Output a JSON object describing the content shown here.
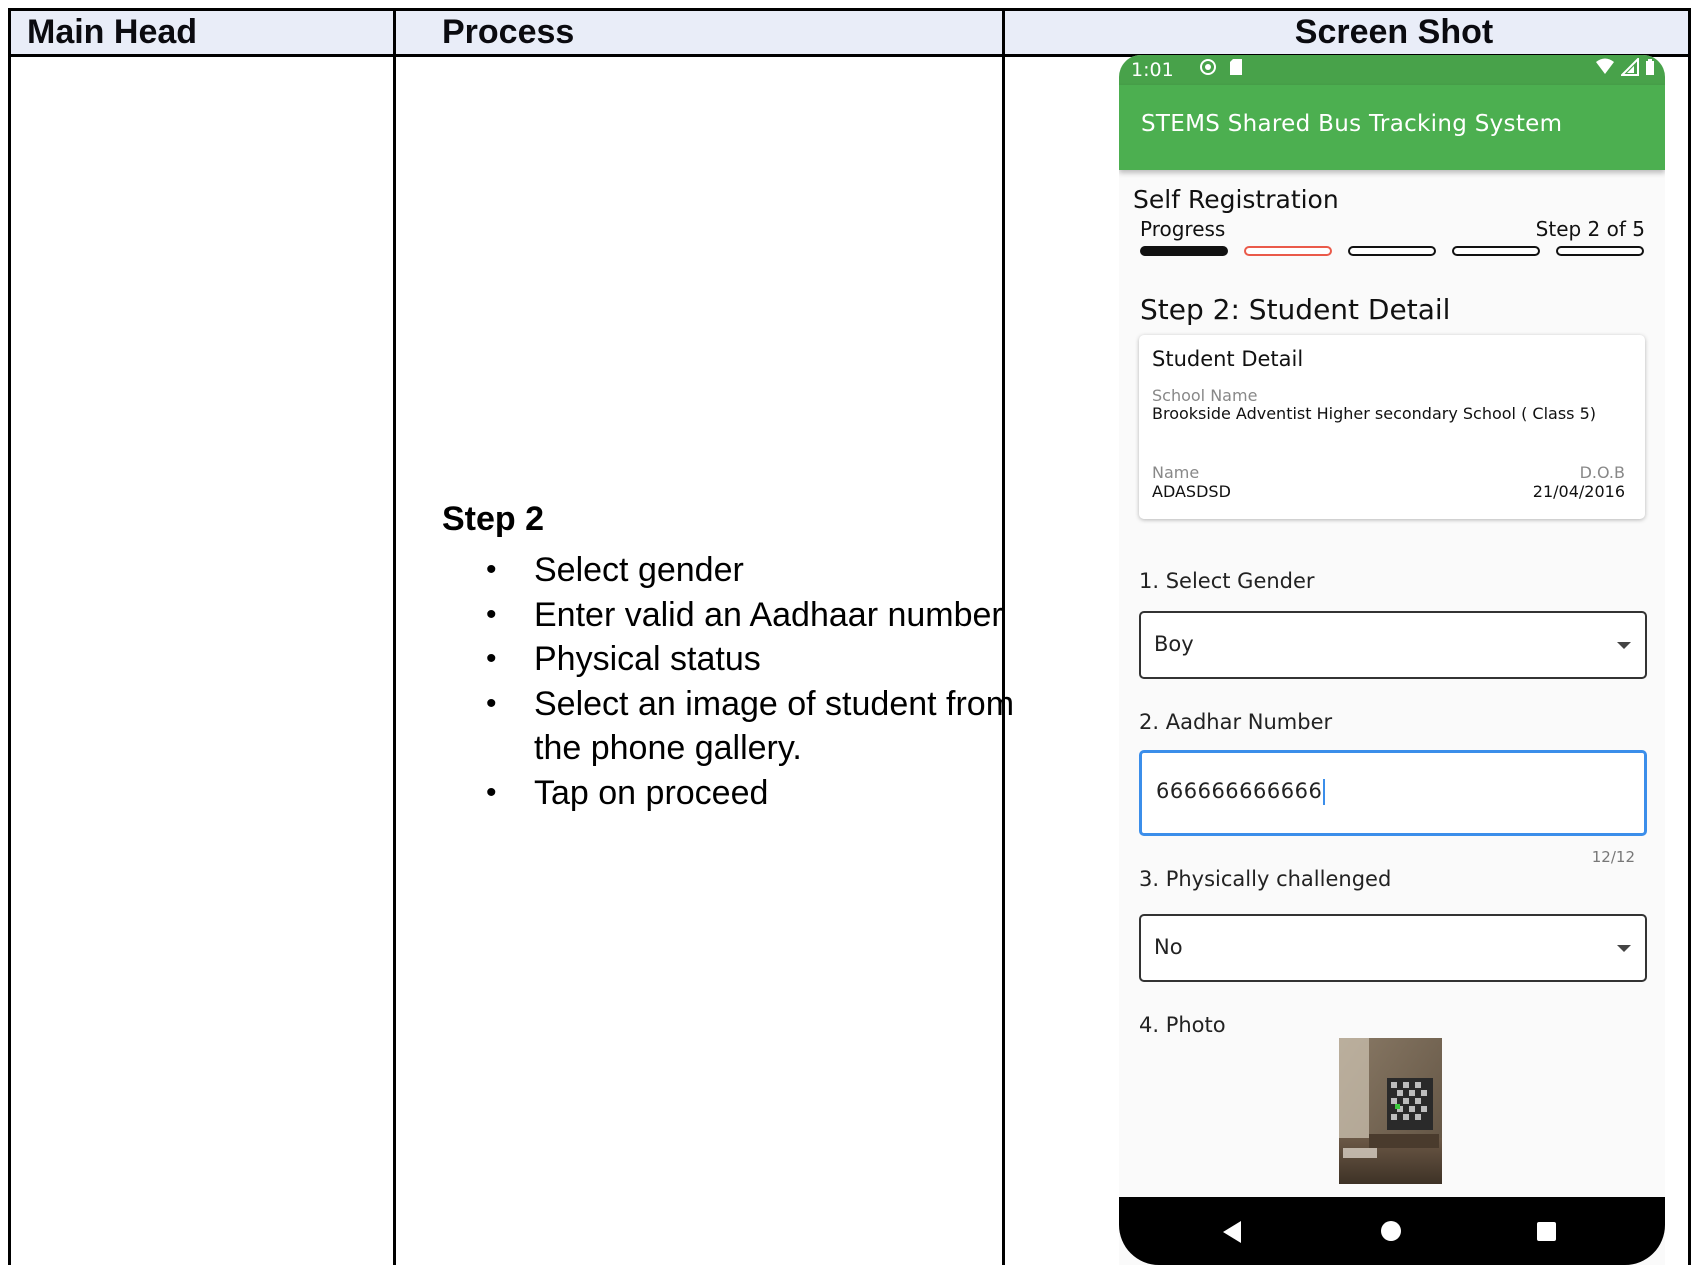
{
  "table": {
    "headers": [
      "Main Head",
      "Process",
      "Screen Shot"
    ]
  },
  "process": {
    "title": "Step 2",
    "bullets": [
      "Select gender",
      "Enter valid an Aadhaar number",
      "Physical status",
      "Select an image of student from the phone gallery.",
      "Tap on proceed"
    ]
  },
  "phone": {
    "status_time": "1:01",
    "app_title": "STEMS Shared Bus Tracking System",
    "registration_title": "Self Registration",
    "progress_label": "Progress",
    "step_indicator": "Step 2 of 5",
    "progress": {
      "current_step": 2,
      "total_steps": 5
    },
    "section_heading": "Step 2: Student Detail",
    "card": {
      "title": "Student Detail",
      "school_label": "School Name",
      "school_value": "Brookside Adventist Higher secondary School ( Class 5)",
      "name_label": "Name",
      "name_value": "ADASDSD",
      "dob_label": "D.O.B",
      "dob_value": "21/04/2016"
    },
    "gender": {
      "label": "1. Select Gender",
      "value": "Boy"
    },
    "aadhar": {
      "label": "2. Aadhar Number",
      "value": "666666666666",
      "counter": "12/12"
    },
    "physical": {
      "label": "3. Physically challenged",
      "value": "No"
    },
    "photo": {
      "label": "4. Photo"
    }
  },
  "colors": {
    "app_bar": "#4caf50",
    "status_bar": "#48a24a",
    "focus_border": "#3b8eea",
    "current_step": "#ea5a4a",
    "header_bg": "#e9edf8"
  },
  "icons": {
    "status": [
      "location-icon",
      "sd-card-icon",
      "wifi-icon",
      "signal-icon",
      "battery-icon"
    ],
    "nav": [
      "back-icon",
      "home-icon",
      "recent-apps-icon"
    ]
  }
}
